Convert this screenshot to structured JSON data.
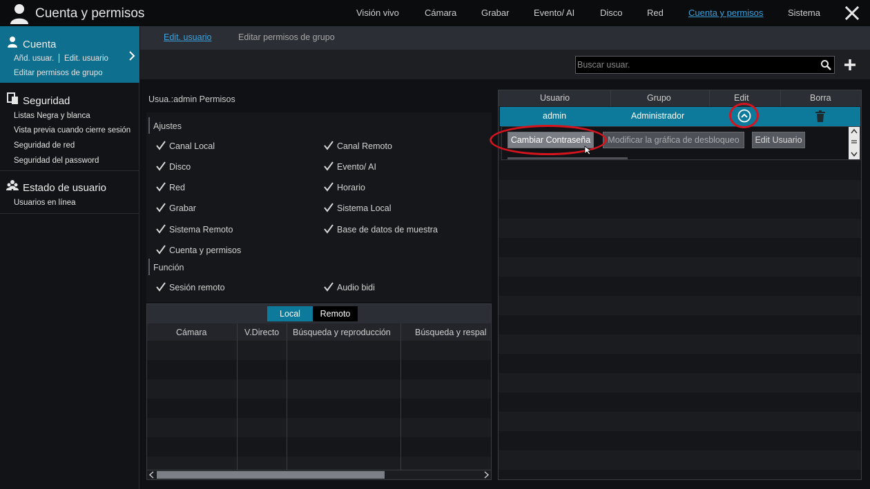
{
  "app": {
    "title": "Cuenta y permisos"
  },
  "nav": {
    "items": [
      "Visión vivo",
      "Cámara",
      "Grabar",
      "Evento/ AI",
      "Disco",
      "Red",
      "Cuenta y permisos",
      "Sistema"
    ],
    "active_index": 6
  },
  "sidebar": {
    "cuenta": {
      "title": "Cuenta",
      "items": [
        "Añd. usuar.",
        "Edit. usuario",
        "Editar permisos de grupo"
      ]
    },
    "seguridad": {
      "title": "Seguridad",
      "items": [
        "Listas Negra y blanca",
        "Vista previa cuando cierre sesión",
        "Seguridad de red",
        "Seguridad del password"
      ]
    },
    "estado": {
      "title": "Estado de usuario",
      "items": [
        "Usuarios en línea"
      ]
    }
  },
  "subtabs": [
    "Edit. usuario",
    "Editar permisos de grupo"
  ],
  "search": {
    "placeholder": "Buscar usuar."
  },
  "permissions": {
    "header": "Usua.:admin Permisos",
    "ajustes_label": "Ajustes",
    "ajustes": [
      "Canal Local",
      "Canal Remoto",
      "Disco",
      "Evento/ AI",
      "Red",
      "Horario",
      "Grabar",
      "Sistema Local",
      "Sistema Remoto",
      "Base de datos de muestra",
      "Cuenta y permisos"
    ],
    "funcion_label": "Función",
    "funcion": [
      "Sesión remoto",
      "Audio bidi"
    ]
  },
  "camera_table": {
    "tabs": [
      "Local",
      "Remoto"
    ],
    "active_tab": 0,
    "columns": [
      "Cámara",
      "V.Directo",
      "Búsqueda y reproducción",
      "Búsqueda y respal"
    ]
  },
  "user_table": {
    "columns": [
      "Usuario",
      "Grupo",
      "Edit",
      "Borra"
    ],
    "rows": [
      {
        "usuario": "admin",
        "grupo": "Administrador"
      }
    ],
    "actions": [
      "Cambiar Contraseña",
      "Modificar la gráfica de desbloqueo",
      "Edit Usuario"
    ]
  },
  "colors": {
    "accent": "#0e7a9b",
    "link": "#3aa3e0",
    "annotation": "#d6141e"
  }
}
